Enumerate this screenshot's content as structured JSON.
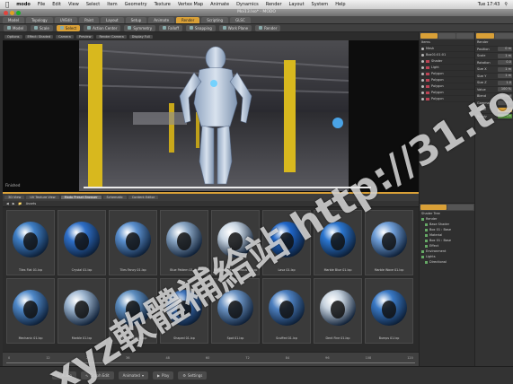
{
  "mac_menu": {
    "app": "modo",
    "items": [
      "File",
      "Edit",
      "View",
      "Select",
      "Item",
      "Geometry",
      "Texture",
      "Vertex Map",
      "Animate",
      "Dynamics",
      "Render",
      "Layout",
      "System",
      "Help"
    ],
    "clock": "Tue 17:43"
  },
  "window": {
    "title": "Moi13.lxo* - MODO"
  },
  "layout_tabs": [
    "Model",
    "Topology",
    "UVEdit",
    "Paint",
    "Layout",
    "Setup",
    "Animate",
    "Render",
    "Scripting",
    "GLSC"
  ],
  "active_layout_tab": "Render",
  "toolbar": {
    "items": [
      "Model",
      "Scale",
      "Select",
      "Action Center",
      "Symmetry",
      "Falloff",
      "Snapping",
      "Work Plane",
      "Render"
    ],
    "active": "Select"
  },
  "viewport": {
    "header_items": [
      "Options",
      "Effect: Shaded",
      "Camera",
      "Preview"
    ],
    "sub_items": [
      "Render Camera",
      "Display Full"
    ],
    "status": "Finished"
  },
  "browser": {
    "tabs": [
      "3D View",
      "UV Texture View",
      "Modo Preset Browser",
      "Schematic",
      "Content Editor"
    ],
    "active_tab": "Modo Preset Browser",
    "path": "Assets",
    "presets": [
      {
        "name": "Tiles Flat 01.lxp",
        "color": "#3f7fc6"
      },
      {
        "name": "Crystal 01.lxp",
        "color": "#2e6fc8"
      },
      {
        "name": "Tiles Fancy 01.lxp",
        "color": "#5a8fce"
      },
      {
        "name": "Blue Pattern 01.lxp",
        "color": "#8aa6c4"
      },
      {
        "name": "Marble Heterogeneous 01.lxp",
        "color": "#c9d6e3"
      },
      {
        "name": "Lava 01.lxp",
        "color": "#1f66c9"
      },
      {
        "name": "Marble Blue 01.lxp",
        "color": "#2b76d0"
      },
      {
        "name": "Marble Wave 01.lxp",
        "color": "#6f9ed8"
      },
      {
        "name": "Mechanic 01.lxp",
        "color": "#4f88c8"
      },
      {
        "name": "Marble 01.lxp",
        "color": "#9fb7d1"
      },
      {
        "name": "Rusty Metal 01.lxp",
        "color": "#5e8ec0"
      },
      {
        "name": "Shaped 01.lxp",
        "color": "#3e74bd"
      },
      {
        "name": "Spot 01.lxp",
        "color": "#6c94c4"
      },
      {
        "name": "Scuffed 01.lxp",
        "color": "#4d80c0"
      },
      {
        "name": "Dent Fine 01.lxp",
        "color": "#c7d3df"
      },
      {
        "name": "Bumps 01.lxp",
        "color": "#3978c4"
      }
    ]
  },
  "item_list": {
    "header": "Items",
    "rows": [
      "Mesh",
      "Box01:01:01",
      "Shader",
      "Light",
      "Polygon",
      "Polygon",
      "Polygon",
      "Polygon",
      "Polygon"
    ]
  },
  "properties": {
    "header": "Render",
    "rows": [
      {
        "label": "Position",
        "value": "0 m"
      },
      {
        "label": "Scale",
        "value": "1 m"
      },
      {
        "label": "Rotation",
        "value": "0.0"
      },
      {
        "label": "Size X",
        "value": "1 m"
      },
      {
        "label": "Size Y",
        "value": "1 m"
      },
      {
        "label": "Size Z",
        "value": "1.0"
      },
      {
        "label": "Value",
        "value": "100 %"
      },
      {
        "label": "Blend",
        "value": "Normal"
      },
      {
        "label": "Gamma",
        "value": "1.0"
      },
      {
        "label": "Detail",
        "value": "Off"
      },
      {
        "label": "Ready",
        "value": "On"
      }
    ]
  },
  "shader_tree": {
    "header": "Shader Tree",
    "rows": [
      "Render",
      "Base Shader",
      "Box 01 : Base",
      "Material",
      "Box 01 : Base",
      "Effect",
      "Environment",
      "Lights",
      "Directional"
    ]
  },
  "timeline": {
    "ticks": [
      "0",
      "12",
      "24",
      "36",
      "48",
      "60",
      "72",
      "84",
      "96",
      "108",
      "120"
    ]
  },
  "bottombar": {
    "items": [
      "Audio",
      "Graph Edit",
      "Animated",
      "Play",
      "Settings"
    ]
  },
  "watermark": "xyz軟體補給站 http://31.to",
  "colors": {
    "accent": "#d9a037",
    "panel": "#363636",
    "viewport": "#0d0d0d"
  }
}
